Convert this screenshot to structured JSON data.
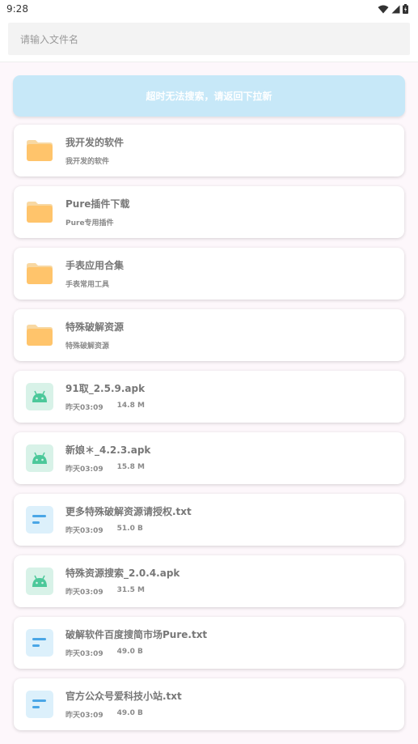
{
  "status": {
    "time": "9:28"
  },
  "search": {
    "placeholder": "请输入文件名"
  },
  "notice": "超时无法搜索，请返回下拉新",
  "items": [
    {
      "type": "folder",
      "title": "我开发的软件",
      "subtitle": "我开发的软件"
    },
    {
      "type": "folder",
      "title": "Pure插件下载",
      "subtitle": "Pure专用插件"
    },
    {
      "type": "folder",
      "title": "手表应用合集",
      "subtitle": "手表常用工具"
    },
    {
      "type": "folder",
      "title": "特殊破解资源",
      "subtitle": "特殊破解资源"
    },
    {
      "type": "apk",
      "title": "91取_2.5.9.apk",
      "date": "昨天03:09",
      "size": "14.8 M"
    },
    {
      "type": "apk",
      "title": "新娘＊_4.2.3.apk",
      "date": "昨天03:09",
      "size": "15.8 M"
    },
    {
      "type": "txt",
      "title": "更多特殊破解资源请授权.txt",
      "date": "昨天03:09",
      "size": "51.0 B"
    },
    {
      "type": "apk",
      "title": "特殊资源搜索_2.0.4.apk",
      "date": "昨天03:09",
      "size": "31.5 M"
    },
    {
      "type": "txt",
      "title": "破解软件百度搜简市场Pure.txt",
      "date": "昨天03:09",
      "size": "49.0 B"
    },
    {
      "type": "txt",
      "title": "官方公众号爱科技小站.txt",
      "date": "昨天03:09",
      "size": "49.0 B"
    }
  ],
  "colors": {
    "folder": "#ffc46b",
    "apk": "#4cc89a",
    "txt": "#4aa6e6"
  }
}
